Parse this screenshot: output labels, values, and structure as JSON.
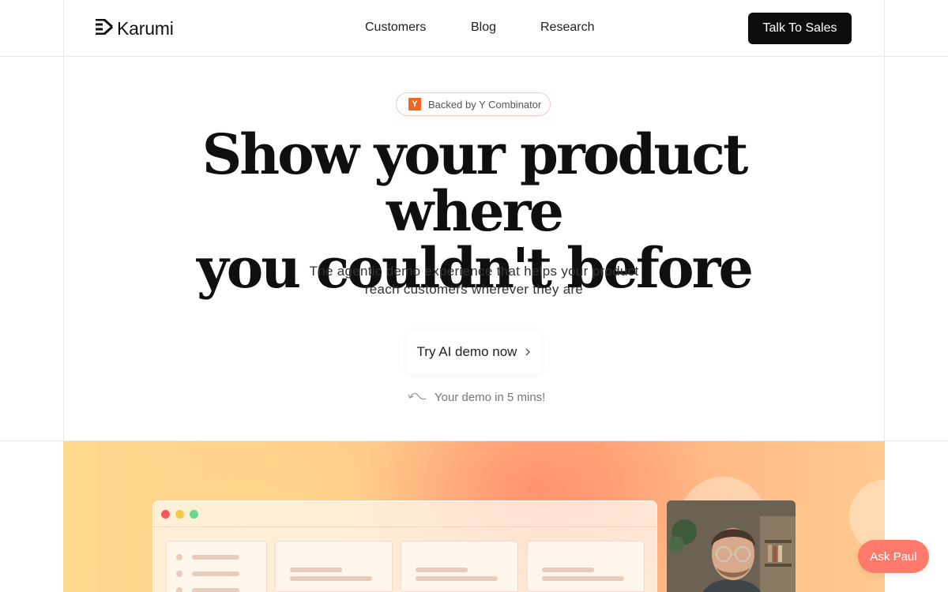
{
  "brand": {
    "name": "Karumi",
    "logo_icon": "karumi-chevrons-icon"
  },
  "nav": {
    "links": [
      "Customers",
      "Blog",
      "Research"
    ],
    "cta": "Talk To Sales"
  },
  "hero": {
    "badge": {
      "icon": "Y",
      "text": "Backed by Y Combinator",
      "icon_color": "#f26625"
    },
    "headline_line1": "Show your product where",
    "headline_line2": "you couldn't before",
    "sub_line1": "The agentic demo experience that helps your product",
    "sub_line2": "reach customers wherever they are",
    "primary_button": "Try AI demo now",
    "demo_note": "Your demo in 5 mins!"
  },
  "chat": {
    "button": "Ask Paul",
    "color": "#ff7a6b"
  },
  "colors": {
    "accent": "#0d0d0d",
    "gradient_warm": "#ffc086",
    "gradient_coral": "#ff8c6e"
  }
}
